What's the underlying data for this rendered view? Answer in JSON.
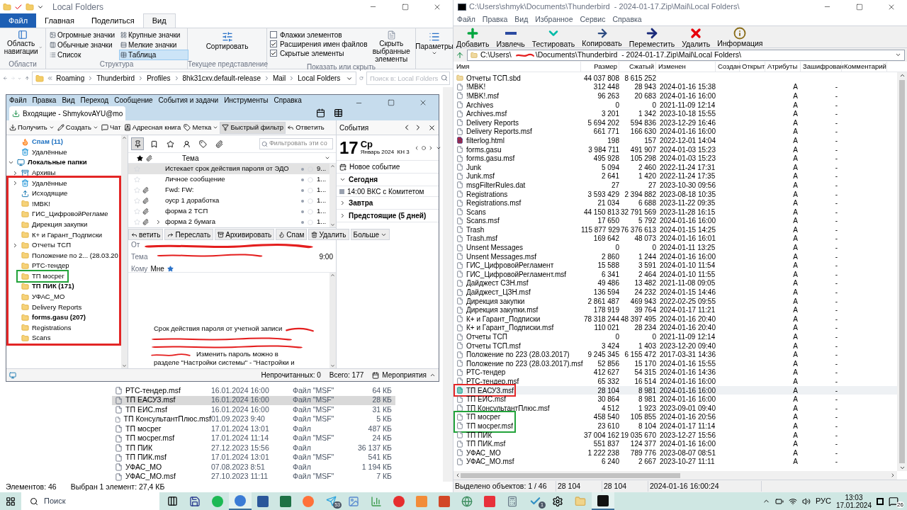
{
  "explorer": {
    "title": "Local Folders",
    "ribbon_tabs": [
      {
        "label": "Файл",
        "kind": "file",
        "selected": false
      },
      {
        "label": "Главная",
        "kind": "tab",
        "selected": false
      },
      {
        "label": "Поделиться",
        "kind": "tab",
        "selected": false
      },
      {
        "label": "Вид",
        "kind": "tab",
        "selected": true
      }
    ],
    "ribbon": {
      "nav_pane": "Область навигации",
      "areas_group": "Области",
      "layouts": [
        {
          "label": "Огромные значки",
          "selected": false
        },
        {
          "label": "Крупные значки",
          "selected": false
        },
        {
          "label": "Обычные значки",
          "selected": false
        },
        {
          "label": "Мелкие значки",
          "selected": false
        },
        {
          "label": "Список",
          "selected": false
        },
        {
          "label": "Таблица",
          "selected": true
        }
      ],
      "layout_group": "Структура",
      "sort": "Сортировать",
      "view_group": "Текущее представление",
      "options": [
        {
          "label": "Флажки элементов",
          "checked": false
        },
        {
          "label": "Расширения имен файлов",
          "checked": true
        },
        {
          "label": "Скрытые элементы",
          "checked": true
        }
      ],
      "hide_selected": "Скрыть выбранные элементы",
      "show_group": "Показать или скрыть",
      "params": "Параметры"
    },
    "breadcrumb": [
      "Roaming",
      "Thunderbird",
      "Profiles",
      "8hk31cxv.default-release",
      "Mail",
      "Local Folders"
    ],
    "search": {
      "placeholder": "Поиск в: Local Folders"
    },
    "files": [
      {
        "name": "РТС-тендер.msf",
        "date": "16.01.2024 16:00",
        "type": "Файл \"MSF\"",
        "size": "64 КБ",
        "selected": false
      },
      {
        "name": "ТП ЕАСУЗ.msf",
        "date": "16.01.2024 16:00",
        "type": "Файл \"MSF\"",
        "size": "28 КБ",
        "selected": true
      },
      {
        "name": "ТП ЕИС.msf",
        "date": "16.01.2024 16:00",
        "type": "Файл \"MSF\"",
        "size": "31 КБ",
        "selected": false
      },
      {
        "name": "ТП КонсультантПлюс.msf",
        "date": "01.09.2023 9:40",
        "type": "Файл \"MSF\"",
        "size": "5 КБ",
        "selected": false
      },
      {
        "name": "ТП мосрег",
        "date": "17.01.2024 13:01",
        "type": "Файл",
        "size": "487 КБ",
        "selected": false
      },
      {
        "name": "ТП мосрег.msf",
        "date": "17.01.2024 11:14",
        "type": "Файл \"MSF\"",
        "size": "24 КБ",
        "selected": false
      },
      {
        "name": "ТП ПИК",
        "date": "27.12.2023 15:56",
        "type": "Файл",
        "size": "36 137 КБ",
        "selected": false
      },
      {
        "name": "ТП ПИК.msf",
        "date": "17.01.2024 13:01",
        "type": "Файл \"MSF\"",
        "size": "541 КБ",
        "selected": false
      },
      {
        "name": "УФАС_МО",
        "date": "07.08.2023 8:51",
        "type": "Файл",
        "size": "1 194 КБ",
        "selected": false
      },
      {
        "name": "УФАС_МО.msf",
        "date": "27.10.2023 11:11",
        "type": "Файл \"MSF\"",
        "size": "7 КБ",
        "selected": false
      }
    ],
    "status": [
      "Элементов: 46",
      "Выбран 1 элемент: 27,4 КБ"
    ]
  },
  "thunderbird": {
    "menu": [
      "Файл",
      "Правка",
      "Вид",
      "Переход",
      "Сообщение",
      "События и задачи",
      "Инструменты",
      "Справка"
    ],
    "tab": "Входящие - ShmykovAYU@mo",
    "toolbar": [
      {
        "label": "Получить",
        "kind": "get",
        "dropdown": true,
        "selected": false
      },
      {
        "label": "Создать",
        "kind": "write",
        "dropdown": true,
        "selected": false
      },
      {
        "label": "Чат",
        "kind": "chat",
        "dropdown": false,
        "selected": false
      },
      {
        "label": "Адресная книга",
        "kind": "contacts",
        "dropdown": false,
        "selected": false
      },
      {
        "label": "Метка",
        "kind": "tag",
        "dropdown": true,
        "selected": false
      },
      {
        "label": "Быстрый фильтр",
        "kind": "filter",
        "dropdown": false,
        "selected": true
      },
      {
        "label": "Ответить",
        "kind": "reply",
        "dropdown": false,
        "selected": false
      }
    ],
    "folders": [
      {
        "label": "Спам (11)",
        "kind": "spam",
        "unread": true
      },
      {
        "label": "Удалённые",
        "kind": "trash",
        "unread": false
      },
      {
        "label": "Локальные папки",
        "kind": "local",
        "unread": true,
        "expanded": true,
        "children": [
          {
            "label": "Архивы",
            "kind": "archive",
            "unread": false,
            "expanded": false
          },
          {
            "label": "Удалённые",
            "kind": "trash",
            "unread": false,
            "expanded": false,
            "color": "#e32626"
          },
          {
            "label": "Исходящие",
            "kind": "outbox",
            "unread": false,
            "color": "#e32626"
          },
          {
            "label": "!MBK!",
            "kind": "folder",
            "unread": false,
            "color": "#e32626"
          },
          {
            "label": "ГИС_ЦифровойРегламе",
            "kind": "folder",
            "unread": false,
            "color": "#e32626"
          },
          {
            "label": "Дирекция закупки",
            "kind": "folder",
            "unread": false,
            "color": "#e32626"
          },
          {
            "label": "К+ и Гарант_Подписки",
            "kind": "folder",
            "unread": false,
            "color": "#e32626"
          },
          {
            "label": "Отчеты ТСП",
            "kind": "folder",
            "unread": false,
            "expanded": false,
            "color": "#e32626"
          },
          {
            "label": "Положение по 2... (28.03.20",
            "kind": "folder",
            "unread": false,
            "color": "#e32626"
          },
          {
            "label": "РТС-тендер",
            "kind": "folder",
            "unread": false,
            "color": "#e32626"
          },
          {
            "label": "ТП мосрег",
            "kind": "folder",
            "unread": false,
            "color": "#22a33a"
          },
          {
            "label": "ТП ПИК (171)",
            "kind": "folder",
            "unread": true,
            "color": "#e32626"
          },
          {
            "label": "УФАС_МО",
            "kind": "folder",
            "unread": false,
            "color": "#e32626"
          },
          {
            "label": "Delivery Reports",
            "kind": "folder",
            "unread": false,
            "color": "#e32626"
          },
          {
            "label": "forms.gasu (207)",
            "kind": "folder",
            "unread": true,
            "color": "#e32626"
          },
          {
            "label": "Registrations",
            "kind": "folder",
            "unread": false,
            "color": "#e32626"
          },
          {
            "label": "Scans",
            "kind": "folder",
            "unread": false,
            "color": "#e32626"
          }
        ]
      }
    ],
    "quick_filters": [
      {
        "kind": "sticky",
        "selected": true
      },
      {
        "kind": "unread",
        "selected": false
      },
      {
        "kind": "starred",
        "selected": false
      },
      {
        "kind": "contact",
        "selected": false
      },
      {
        "kind": "tag",
        "selected": false
      },
      {
        "kind": "attachment",
        "selected": false
      }
    ],
    "filter_placeholder": "Фильтровать эти со",
    "subject_column": "Тема",
    "messages": [
      {
        "subject": "Истекает срок действия пароля от ЭДО",
        "date": "9...",
        "attachment": false,
        "thread": false,
        "selected": true
      },
      {
        "subject": "Личное сообщение",
        "date": "1...",
        "attachment": false,
        "thread": false,
        "selected": false
      },
      {
        "subject": "Fwd: FW:",
        "date": "1...",
        "attachment": true,
        "thread": false,
        "selected": false
      },
      {
        "subject": "оуср 1 доработка",
        "date": "1...",
        "attachment": true,
        "thread": false,
        "selected": false
      },
      {
        "subject": "форма 2 ТСП",
        "date": "1...",
        "attachment": true,
        "thread": false,
        "selected": false
      },
      {
        "subject": "форма 2 бумага",
        "date": "1...",
        "attachment": true,
        "thread": true,
        "selected": false
      }
    ],
    "actions": [
      {
        "label": "ветить",
        "kind": "reply"
      },
      {
        "label": "Переслать",
        "kind": "forward"
      },
      {
        "label": "Архивировать",
        "kind": "archive"
      },
      {
        "label": "Спам",
        "kind": "spam"
      },
      {
        "label": "Удалить",
        "kind": "delete"
      },
      {
        "label": "Больше",
        "kind": "more"
      }
    ],
    "header": {
      "from_label": "От",
      "subject_label": "Тема",
      "time": "9:00",
      "to_label": "Кому",
      "to": "Мне"
    },
    "body": [
      "Срок действия пароля от учетной записи",
      "Изменить пароль можно в",
      "разделе \"Настройки системы\" - \"Настройки и"
    ],
    "events": {
      "title": "События",
      "day": "17",
      "weekday": "Ср",
      "month": "Январь 2024  КН 3",
      "new_event": "Новое событие",
      "sections": [
        {
          "label": "Сегодня",
          "expanded": true,
          "items": [
            "14:00 ВКС с Комитетом"
          ]
        },
        {
          "label": "Завтра",
          "expanded": false
        },
        {
          "label": "Предстоящие (5 дней)",
          "expanded": false
        }
      ]
    },
    "status": [
      "Непрочитанных: 0",
      "Всего: 177"
    ],
    "agenda": "Мероприятия"
  },
  "sevenzip": {
    "title": "C:\\Users\\shmyk\\Documents\\Thunderbird  - 2024-01-17.Zip\\Mail\\Local Folders\\",
    "menu": [
      "Файл",
      "Правка",
      "Вид",
      "Избранное",
      "Сервис",
      "Справка"
    ],
    "toolbar": [
      {
        "label": "Добавить",
        "kind": "add"
      },
      {
        "label": "Извлечь",
        "kind": "extract"
      },
      {
        "label": "Тестировать",
        "kind": "test"
      },
      {
        "label": "Копировать",
        "kind": "copy"
      },
      {
        "label": "Переместить",
        "kind": "move"
      },
      {
        "label": "Удалить",
        "kind": "delete"
      },
      {
        "label": "Информация",
        "kind": "info"
      }
    ],
    "path": [
      "C:\\Users\\",
      "\\Documents\\Thunderbird  - 2024-01-17.Zip\\Mail\\Local Folders\\"
    ],
    "columns": [
      "Имя",
      "Размер",
      "Сжатый",
      "Изменен",
      "Создан",
      "Открыт",
      "Атрибуты",
      "Зашифрован",
      "Комментарий"
    ],
    "rows": [
      {
        "name": "Отчеты ТСП.sbd",
        "kind": "folder",
        "size": "44 037 808",
        "packed": "8 615 252",
        "selected": false
      },
      {
        "name": "!MBK!",
        "kind": "file",
        "size": "312 448",
        "packed": "28 943",
        "modified": "2024-01-16 15:38",
        "attributes": "A",
        "encrypted": "-",
        "selected": false
      },
      {
        "name": "!MBK!.msf",
        "kind": "file",
        "size": "96 263",
        "packed": "20 683",
        "modified": "2024-01-16 16:00",
        "attributes": "A",
        "encrypted": "-",
        "selected": false
      },
      {
        "name": "Archives",
        "kind": "file",
        "size": "0",
        "packed": "0",
        "modified": "2021-11-09 12:14",
        "attributes": "A",
        "encrypted": "-",
        "selected": false
      },
      {
        "name": "Archives.msf",
        "kind": "file",
        "size": "3 201",
        "packed": "1 342",
        "modified": "2023-10-18 15:55",
        "attributes": "A",
        "encrypted": "-",
        "selected": false
      },
      {
        "name": "Delivery Reports",
        "kind": "file",
        "size": "5 694 202",
        "packed": "594 836",
        "modified": "2023-12-29 16:46",
        "attributes": "A",
        "encrypted": "-",
        "selected": false
      },
      {
        "name": "Delivery Reports.msf",
        "kind": "file",
        "size": "661 771",
        "packed": "166 630",
        "modified": "2024-01-16 16:00",
        "attributes": "A",
        "encrypted": "-",
        "selected": false
      },
      {
        "name": "filterlog.html",
        "kind": "html",
        "size": "198",
        "packed": "157",
        "modified": "2022-12-01 14:04",
        "attributes": "A",
        "encrypted": "-",
        "selected": false
      },
      {
        "name": "forms.gasu",
        "kind": "file",
        "size": "3 984 711",
        "packed": "491 907",
        "modified": "2024-01-03 15:23",
        "attributes": "A",
        "encrypted": "-",
        "selected": false
      },
      {
        "name": "forms.gasu.msf",
        "kind": "file",
        "size": "495 928",
        "packed": "105 298",
        "modified": "2024-01-03 15:23",
        "attributes": "A",
        "encrypted": "-",
        "selected": false
      },
      {
        "name": "Junk",
        "kind": "file",
        "size": "5 094",
        "packed": "2 460",
        "modified": "2022-11-24 17:31",
        "attributes": "A",
        "encrypted": "-",
        "selected": false
      },
      {
        "name": "Junk.msf",
        "kind": "file",
        "size": "2 641",
        "packed": "1 420",
        "modified": "2022-11-24 17:35",
        "attributes": "A",
        "encrypted": "-",
        "selected": false
      },
      {
        "name": "msgFilterRules.dat",
        "kind": "file",
        "size": "27",
        "packed": "27",
        "modified": "2023-10-30 09:56",
        "attributes": "A",
        "encrypted": "-",
        "selected": false
      },
      {
        "name": "Registrations",
        "kind": "file",
        "size": "3 593 429",
        "packed": "2 394 882",
        "modified": "2023-08-18 10:35",
        "attributes": "A",
        "encrypted": "-",
        "selected": false
      },
      {
        "name": "Registrations.msf",
        "kind": "file",
        "size": "21 034",
        "packed": "6 688",
        "modified": "2023-11-22 09:35",
        "attributes": "A",
        "encrypted": "-",
        "selected": false
      },
      {
        "name": "Scans",
        "kind": "file",
        "size": "44 150 813",
        "packed": "32 791 569",
        "modified": "2023-11-28 16:15",
        "attributes": "A",
        "encrypted": "-",
        "selected": false
      },
      {
        "name": "Scans.msf",
        "kind": "file",
        "size": "17 650",
        "packed": "5 792",
        "modified": "2024-01-16 16:00",
        "attributes": "A",
        "encrypted": "-",
        "selected": false
      },
      {
        "name": "Trash",
        "kind": "file",
        "size": "115 877 929",
        "packed": "76 376 613",
        "modified": "2024-01-15 14:25",
        "attributes": "A",
        "encrypted": "-",
        "selected": false
      },
      {
        "name": "Trash.msf",
        "kind": "file",
        "size": "169 642",
        "packed": "48 073",
        "modified": "2024-01-16 16:01",
        "attributes": "A",
        "encrypted": "-",
        "selected": false
      },
      {
        "name": "Unsent Messages",
        "kind": "file",
        "size": "0",
        "packed": "0",
        "modified": "2024-01-11 13:25",
        "attributes": "A",
        "encrypted": "-",
        "selected": false
      },
      {
        "name": "Unsent Messages.msf",
        "kind": "file",
        "size": "2 860",
        "packed": "1 244",
        "modified": "2024-01-16 16:00",
        "attributes": "A",
        "encrypted": "-",
        "selected": false
      },
      {
        "name": "ГИС_ЦифровойРегламент",
        "kind": "file",
        "size": "15 588",
        "packed": "3 591",
        "modified": "2024-01-10 11:54",
        "attributes": "A",
        "encrypted": "-",
        "selected": false
      },
      {
        "name": "ГИС_ЦифровойРегламент.msf",
        "kind": "file",
        "size": "6 341",
        "packed": "2 464",
        "modified": "2024-01-10 11:55",
        "attributes": "A",
        "encrypted": "-",
        "selected": false
      },
      {
        "name": "Дайджест СЗН.msf",
        "kind": "file",
        "size": "49 486",
        "packed": "13 482",
        "modified": "2021-11-08 09:05",
        "attributes": "A",
        "encrypted": "-",
        "selected": false
      },
      {
        "name": "Дайджест_ЦЗН.msf",
        "kind": "file",
        "size": "136 594",
        "packed": "24 232",
        "modified": "2024-01-15 14:46",
        "attributes": "A",
        "encrypted": "-",
        "selected": false
      },
      {
        "name": "Дирекция закупки",
        "kind": "file",
        "size": "2 861 487",
        "packed": "469 943",
        "modified": "2022-02-25 09:55",
        "attributes": "A",
        "encrypted": "-",
        "selected": false
      },
      {
        "name": "Дирекция закупки.msf",
        "kind": "file",
        "size": "178 919",
        "packed": "39 764",
        "modified": "2024-01-17 11:21",
        "attributes": "A",
        "encrypted": "-",
        "selected": false
      },
      {
        "name": "К+ и Гарант_Подписки",
        "kind": "file",
        "size": "78 318 244",
        "packed": "48 397 495",
        "modified": "2024-01-16 20:40",
        "attributes": "A",
        "encrypted": "-",
        "selected": false
      },
      {
        "name": "К+ и Гарант_Подписки.msf",
        "kind": "file",
        "size": "110 021",
        "packed": "28 234",
        "modified": "2024-01-16 20:40",
        "attributes": "A",
        "encrypted": "-",
        "selected": false
      },
      {
        "name": "Отчеты ТСП",
        "kind": "file",
        "size": "0",
        "packed": "0",
        "modified": "2021-11-09 12:14",
        "attributes": "A",
        "encrypted": "-",
        "selected": false
      },
      {
        "name": "Отчеты ТСП.msf",
        "kind": "file",
        "size": "3 424",
        "packed": "1 403",
        "modified": "2023-12-20 09:40",
        "attributes": "A",
        "encrypted": "-",
        "selected": false
      },
      {
        "name": "Положение по 223 (28.03.2017)",
        "kind": "file",
        "size": "9 245 345",
        "packed": "6 155 472",
        "modified": "2017-03-31 14:36",
        "attributes": "A",
        "encrypted": "-",
        "selected": false
      },
      {
        "name": "Положение по 223 (28.03.2017).msf",
        "kind": "file",
        "size": "52 856",
        "packed": "15 170",
        "modified": "2024-01-16 15:55",
        "attributes": "A",
        "encrypted": "-",
        "selected": false
      },
      {
        "name": "РТС-тендер",
        "kind": "file",
        "size": "412 627",
        "packed": "54 315",
        "modified": "2024-01-16 14:36",
        "attributes": "A",
        "encrypted": "-",
        "selected": false
      },
      {
        "name": "РТС-тендер.msf",
        "kind": "file",
        "size": "65 332",
        "packed": "16 514",
        "modified": "2024-01-16 16:00",
        "attributes": "A",
        "encrypted": "-",
        "selected": false
      },
      {
        "name": "ТП ЕАСУЗ.msf",
        "kind": "file",
        "size": "28 104",
        "packed": "8 981",
        "modified": "2024-01-16 16:00",
        "attributes": "A",
        "encrypted": "-",
        "selected": true,
        "color": "#e32626"
      },
      {
        "name": "ТП ЕИС.msf",
        "kind": "file",
        "size": "30 864",
        "packed": "8 981",
        "modified": "2024-01-16 16:00",
        "attributes": "A",
        "encrypted": "-",
        "selected": false
      },
      {
        "name": "ТП КонсультантПлюс.msf",
        "kind": "file",
        "size": "4 512",
        "packed": "1 923",
        "modified": "2023-09-01 09:40",
        "attributes": "A",
        "encrypted": "-",
        "selected": false
      },
      {
        "name": "ТП мосрег",
        "kind": "file",
        "size": "458 540",
        "packed": "105 855",
        "modified": "2024-01-16 20:56",
        "attributes": "A",
        "encrypted": "-",
        "selected": false,
        "color": "#22a33a"
      },
      {
        "name": "ТП мосрег.msf",
        "kind": "file",
        "size": "23 610",
        "packed": "8 104",
        "modified": "2024-01-17 11:14",
        "attributes": "A",
        "encrypted": "-",
        "selected": false,
        "color": "#22a33a"
      },
      {
        "name": "ТП ПИК",
        "kind": "file",
        "size": "37 004 162",
        "packed": "19 035 670",
        "modified": "2023-12-27 15:56",
        "attributes": "A",
        "encrypted": "-",
        "selected": false
      },
      {
        "name": "ТП ПИК.msf",
        "kind": "file",
        "size": "551 837",
        "packed": "124 377",
        "modified": "2024-01-16 16:00",
        "attributes": "A",
        "encrypted": "-",
        "selected": false
      },
      {
        "name": "УФАС_МО",
        "kind": "file",
        "size": "1 222 238",
        "packed": "789 776",
        "modified": "2023-08-07 08:51",
        "attributes": "A",
        "encrypted": "-",
        "selected": false
      },
      {
        "name": "УФАС_МО.msf",
        "kind": "file",
        "size": "6 240",
        "packed": "2 667",
        "modified": "2023-10-27 11:11",
        "attributes": "A",
        "encrypted": "-",
        "selected": false
      }
    ],
    "status": [
      "Выделено объектов: 1 / 46",
      "28 104",
      "28 104",
      "2024-01-16 16:00:24"
    ]
  },
  "taskbar": {
    "search": "Поиск",
    "apps": [
      {
        "kind": "taskview",
        "active": false
      },
      {
        "kind": "save",
        "active": false
      },
      {
        "kind": "spotify",
        "active": false
      },
      {
        "kind": "thunderbird",
        "active": true
      },
      {
        "kind": "word",
        "active": false
      },
      {
        "kind": "excel",
        "active": false
      },
      {
        "kind": "firefox",
        "active": false
      },
      {
        "kind": "telegram",
        "active": false,
        "badge": "53"
      },
      {
        "kind": "image",
        "active": false
      },
      {
        "kind": "chart",
        "active": false
      },
      {
        "kind": "yandex",
        "active": false
      },
      {
        "kind": "reader",
        "active": false
      },
      {
        "kind": "powerpoint",
        "active": false
      },
      {
        "kind": "globe",
        "active": false
      },
      {
        "kind": "redsquare",
        "active": false
      },
      {
        "kind": "calculator",
        "active": false
      },
      {
        "kind": "check",
        "active": false,
        "badge": "1"
      },
      {
        "kind": "gear",
        "active": false
      },
      {
        "kind": "folder",
        "active": false
      },
      {
        "kind": "sevenzip",
        "active": true
      }
    ],
    "lang": "РУС",
    "time": "13:03",
    "date": "17.01.2024",
    "notifications": "26"
  }
}
